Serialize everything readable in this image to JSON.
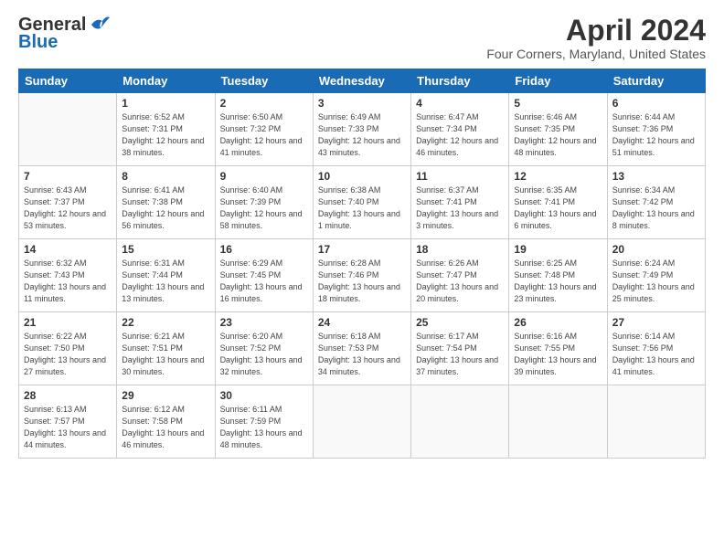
{
  "header": {
    "logo_general": "General",
    "logo_blue": "Blue",
    "month_year": "April 2024",
    "location": "Four Corners, Maryland, United States"
  },
  "days_of_week": [
    "Sunday",
    "Monday",
    "Tuesday",
    "Wednesday",
    "Thursday",
    "Friday",
    "Saturday"
  ],
  "weeks": [
    [
      {
        "day": "",
        "sunrise": "",
        "sunset": "",
        "daylight": ""
      },
      {
        "day": "1",
        "sunrise": "Sunrise: 6:52 AM",
        "sunset": "Sunset: 7:31 PM",
        "daylight": "Daylight: 12 hours and 38 minutes."
      },
      {
        "day": "2",
        "sunrise": "Sunrise: 6:50 AM",
        "sunset": "Sunset: 7:32 PM",
        "daylight": "Daylight: 12 hours and 41 minutes."
      },
      {
        "day": "3",
        "sunrise": "Sunrise: 6:49 AM",
        "sunset": "Sunset: 7:33 PM",
        "daylight": "Daylight: 12 hours and 43 minutes."
      },
      {
        "day": "4",
        "sunrise": "Sunrise: 6:47 AM",
        "sunset": "Sunset: 7:34 PM",
        "daylight": "Daylight: 12 hours and 46 minutes."
      },
      {
        "day": "5",
        "sunrise": "Sunrise: 6:46 AM",
        "sunset": "Sunset: 7:35 PM",
        "daylight": "Daylight: 12 hours and 48 minutes."
      },
      {
        "day": "6",
        "sunrise": "Sunrise: 6:44 AM",
        "sunset": "Sunset: 7:36 PM",
        "daylight": "Daylight: 12 hours and 51 minutes."
      }
    ],
    [
      {
        "day": "7",
        "sunrise": "Sunrise: 6:43 AM",
        "sunset": "Sunset: 7:37 PM",
        "daylight": "Daylight: 12 hours and 53 minutes."
      },
      {
        "day": "8",
        "sunrise": "Sunrise: 6:41 AM",
        "sunset": "Sunset: 7:38 PM",
        "daylight": "Daylight: 12 hours and 56 minutes."
      },
      {
        "day": "9",
        "sunrise": "Sunrise: 6:40 AM",
        "sunset": "Sunset: 7:39 PM",
        "daylight": "Daylight: 12 hours and 58 minutes."
      },
      {
        "day": "10",
        "sunrise": "Sunrise: 6:38 AM",
        "sunset": "Sunset: 7:40 PM",
        "daylight": "Daylight: 13 hours and 1 minute."
      },
      {
        "day": "11",
        "sunrise": "Sunrise: 6:37 AM",
        "sunset": "Sunset: 7:41 PM",
        "daylight": "Daylight: 13 hours and 3 minutes."
      },
      {
        "day": "12",
        "sunrise": "Sunrise: 6:35 AM",
        "sunset": "Sunset: 7:41 PM",
        "daylight": "Daylight: 13 hours and 6 minutes."
      },
      {
        "day": "13",
        "sunrise": "Sunrise: 6:34 AM",
        "sunset": "Sunset: 7:42 PM",
        "daylight": "Daylight: 13 hours and 8 minutes."
      }
    ],
    [
      {
        "day": "14",
        "sunrise": "Sunrise: 6:32 AM",
        "sunset": "Sunset: 7:43 PM",
        "daylight": "Daylight: 13 hours and 11 minutes."
      },
      {
        "day": "15",
        "sunrise": "Sunrise: 6:31 AM",
        "sunset": "Sunset: 7:44 PM",
        "daylight": "Daylight: 13 hours and 13 minutes."
      },
      {
        "day": "16",
        "sunrise": "Sunrise: 6:29 AM",
        "sunset": "Sunset: 7:45 PM",
        "daylight": "Daylight: 13 hours and 16 minutes."
      },
      {
        "day": "17",
        "sunrise": "Sunrise: 6:28 AM",
        "sunset": "Sunset: 7:46 PM",
        "daylight": "Daylight: 13 hours and 18 minutes."
      },
      {
        "day": "18",
        "sunrise": "Sunrise: 6:26 AM",
        "sunset": "Sunset: 7:47 PM",
        "daylight": "Daylight: 13 hours and 20 minutes."
      },
      {
        "day": "19",
        "sunrise": "Sunrise: 6:25 AM",
        "sunset": "Sunset: 7:48 PM",
        "daylight": "Daylight: 13 hours and 23 minutes."
      },
      {
        "day": "20",
        "sunrise": "Sunrise: 6:24 AM",
        "sunset": "Sunset: 7:49 PM",
        "daylight": "Daylight: 13 hours and 25 minutes."
      }
    ],
    [
      {
        "day": "21",
        "sunrise": "Sunrise: 6:22 AM",
        "sunset": "Sunset: 7:50 PM",
        "daylight": "Daylight: 13 hours and 27 minutes."
      },
      {
        "day": "22",
        "sunrise": "Sunrise: 6:21 AM",
        "sunset": "Sunset: 7:51 PM",
        "daylight": "Daylight: 13 hours and 30 minutes."
      },
      {
        "day": "23",
        "sunrise": "Sunrise: 6:20 AM",
        "sunset": "Sunset: 7:52 PM",
        "daylight": "Daylight: 13 hours and 32 minutes."
      },
      {
        "day": "24",
        "sunrise": "Sunrise: 6:18 AM",
        "sunset": "Sunset: 7:53 PM",
        "daylight": "Daylight: 13 hours and 34 minutes."
      },
      {
        "day": "25",
        "sunrise": "Sunrise: 6:17 AM",
        "sunset": "Sunset: 7:54 PM",
        "daylight": "Daylight: 13 hours and 37 minutes."
      },
      {
        "day": "26",
        "sunrise": "Sunrise: 6:16 AM",
        "sunset": "Sunset: 7:55 PM",
        "daylight": "Daylight: 13 hours and 39 minutes."
      },
      {
        "day": "27",
        "sunrise": "Sunrise: 6:14 AM",
        "sunset": "Sunset: 7:56 PM",
        "daylight": "Daylight: 13 hours and 41 minutes."
      }
    ],
    [
      {
        "day": "28",
        "sunrise": "Sunrise: 6:13 AM",
        "sunset": "Sunset: 7:57 PM",
        "daylight": "Daylight: 13 hours and 44 minutes."
      },
      {
        "day": "29",
        "sunrise": "Sunrise: 6:12 AM",
        "sunset": "Sunset: 7:58 PM",
        "daylight": "Daylight: 13 hours and 46 minutes."
      },
      {
        "day": "30",
        "sunrise": "Sunrise: 6:11 AM",
        "sunset": "Sunset: 7:59 PM",
        "daylight": "Daylight: 13 hours and 48 minutes."
      },
      {
        "day": "",
        "sunrise": "",
        "sunset": "",
        "daylight": ""
      },
      {
        "day": "",
        "sunrise": "",
        "sunset": "",
        "daylight": ""
      },
      {
        "day": "",
        "sunrise": "",
        "sunset": "",
        "daylight": ""
      },
      {
        "day": "",
        "sunrise": "",
        "sunset": "",
        "daylight": ""
      }
    ]
  ]
}
